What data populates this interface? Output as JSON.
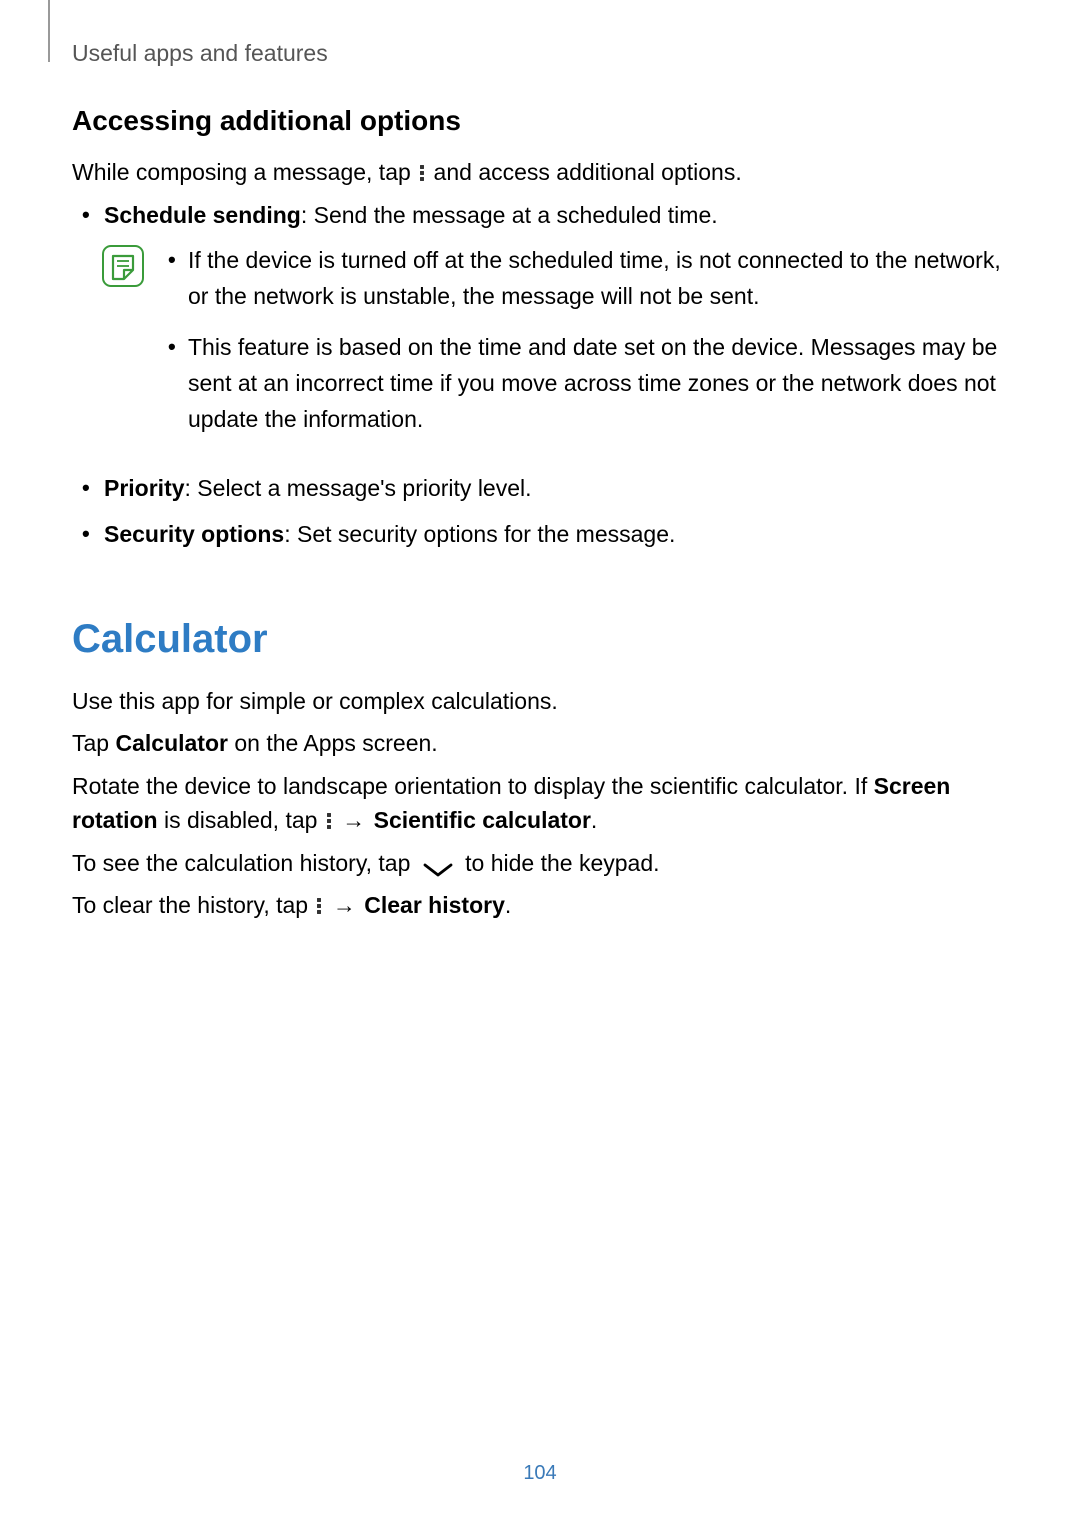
{
  "header": {
    "title": "Useful apps and features"
  },
  "section1": {
    "subheading": "Accessing additional options",
    "intro_before": "While composing a message, tap ",
    "intro_after": " and access additional options.",
    "bullets": [
      {
        "bold": "Schedule sending",
        "text": ": Send the message at a scheduled time."
      }
    ],
    "note_items": [
      "If the device is turned off at the scheduled time, is not connected to the network, or the network is unstable, the message will not be sent.",
      "This feature is based on the time and date set on the device. Messages may be sent at an incorrect time if you move across time zones or the network does not update the information."
    ],
    "bullets2": [
      {
        "bold": "Priority",
        "text": ": Select a message's priority level."
      },
      {
        "bold": "Security options",
        "text": ": Set security options for the message."
      }
    ]
  },
  "section2": {
    "heading": "Calculator",
    "p1": "Use this app for simple or complex calculations.",
    "p2_before": "Tap ",
    "p2_bold": "Calculator",
    "p2_after": " on the Apps screen.",
    "p3_before": "Rotate the device to landscape orientation to display the scientific calculator. If ",
    "p3_bold1": "Screen rotation",
    "p3_mid": " is disabled, tap ",
    "p3_arrow": " → ",
    "p3_bold2": "Scientific calculator",
    "p3_after": ".",
    "p4_before": "To see the calculation history, tap ",
    "p4_after": " to hide the keypad.",
    "p5_before": "To clear the history, tap ",
    "p5_arrow": " → ",
    "p5_bold": "Clear history",
    "p5_after": "."
  },
  "page_number": "104"
}
